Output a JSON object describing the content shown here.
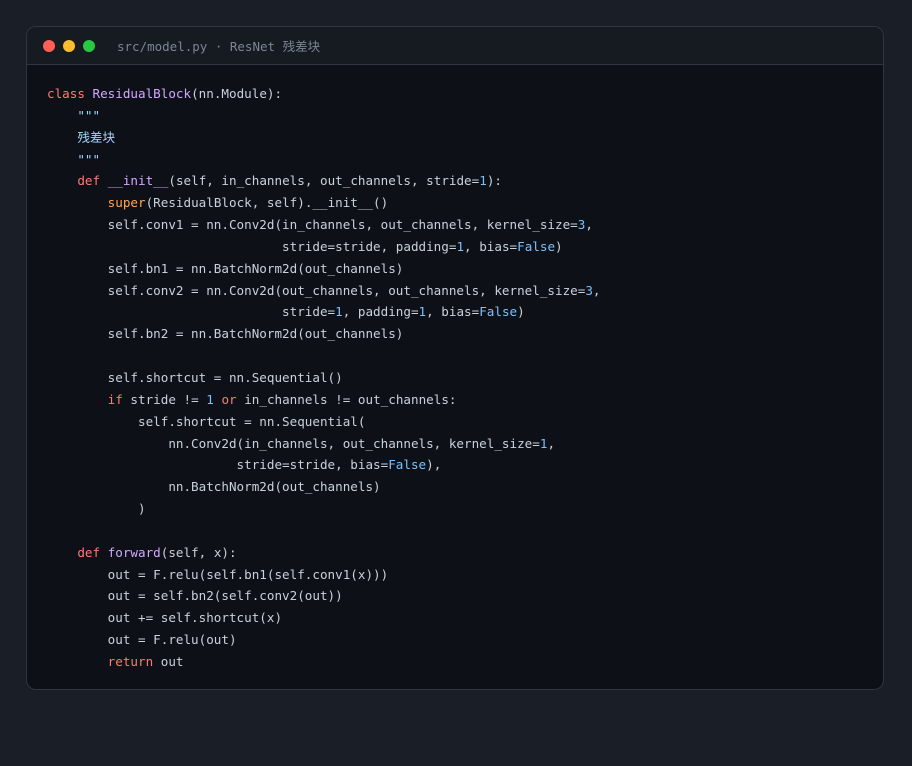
{
  "window": {
    "title": "src/model.py · ResNet 残差块"
  },
  "colors": {
    "background": "#1a1e26",
    "editor_bg": "#0d1117",
    "keyword": "#ff7b72",
    "function": "#d2a8ff",
    "builtin": "#ffa657",
    "number": "#79c0ff",
    "string": "#a5d6ff",
    "text": "#c9d1d9"
  },
  "code": {
    "language": "python",
    "lines": [
      [
        {
          "t": "class",
          "c": "kw"
        },
        {
          "t": " ",
          "c": "plain"
        },
        {
          "t": "ResidualBlock",
          "c": "fn"
        },
        {
          "t": "(nn.Module):",
          "c": "plain"
        }
      ],
      [
        {
          "t": "    \"\"\"",
          "c": "str"
        }
      ],
      [
        {
          "t": "    残差块",
          "c": "str"
        }
      ],
      [
        {
          "t": "    \"\"\"",
          "c": "str"
        }
      ],
      [
        {
          "t": "    ",
          "c": "plain"
        },
        {
          "t": "def",
          "c": "kw"
        },
        {
          "t": " ",
          "c": "plain"
        },
        {
          "t": "__init__",
          "c": "fn"
        },
        {
          "t": "(self, in_channels, out_channels, stride=",
          "c": "plain"
        },
        {
          "t": "1",
          "c": "num"
        },
        {
          "t": "):",
          "c": "plain"
        }
      ],
      [
        {
          "t": "        ",
          "c": "plain"
        },
        {
          "t": "super",
          "c": "bi"
        },
        {
          "t": "(ResidualBlock, self).__init__()",
          "c": "plain"
        }
      ],
      [
        {
          "t": "        self.conv1 = nn.Conv2d(in_channels, out_channels, kernel_size=",
          "c": "plain"
        },
        {
          "t": "3",
          "c": "num"
        },
        {
          "t": ",",
          "c": "plain"
        }
      ],
      [
        {
          "t": "                               stride=stride, padding=",
          "c": "plain"
        },
        {
          "t": "1",
          "c": "num"
        },
        {
          "t": ", bias=",
          "c": "plain"
        },
        {
          "t": "False",
          "c": "num"
        },
        {
          "t": ")",
          "c": "plain"
        }
      ],
      [
        {
          "t": "        self.bn1 = nn.BatchNorm2d(out_channels)",
          "c": "plain"
        }
      ],
      [
        {
          "t": "        self.conv2 = nn.Conv2d(out_channels, out_channels, kernel_size=",
          "c": "plain"
        },
        {
          "t": "3",
          "c": "num"
        },
        {
          "t": ",",
          "c": "plain"
        }
      ],
      [
        {
          "t": "                               stride=",
          "c": "plain"
        },
        {
          "t": "1",
          "c": "num"
        },
        {
          "t": ", padding=",
          "c": "plain"
        },
        {
          "t": "1",
          "c": "num"
        },
        {
          "t": ", bias=",
          "c": "plain"
        },
        {
          "t": "False",
          "c": "num"
        },
        {
          "t": ")",
          "c": "plain"
        }
      ],
      [
        {
          "t": "        self.bn2 = nn.BatchNorm2d(out_channels)",
          "c": "plain"
        }
      ],
      [],
      [
        {
          "t": "        self.shortcut = nn.Sequential()",
          "c": "plain"
        }
      ],
      [
        {
          "t": "        ",
          "c": "plain"
        },
        {
          "t": "if",
          "c": "kw"
        },
        {
          "t": " stride != ",
          "c": "plain"
        },
        {
          "t": "1",
          "c": "num"
        },
        {
          "t": " ",
          "c": "plain"
        },
        {
          "t": "or",
          "c": "kw"
        },
        {
          "t": " in_channels != out_channels:",
          "c": "plain"
        }
      ],
      [
        {
          "t": "            self.shortcut = nn.Sequential(",
          "c": "plain"
        }
      ],
      [
        {
          "t": "                nn.Conv2d(in_channels, out_channels, kernel_size=",
          "c": "plain"
        },
        {
          "t": "1",
          "c": "num"
        },
        {
          "t": ",",
          "c": "plain"
        }
      ],
      [
        {
          "t": "                         stride=stride, bias=",
          "c": "plain"
        },
        {
          "t": "False",
          "c": "num"
        },
        {
          "t": "),",
          "c": "plain"
        }
      ],
      [
        {
          "t": "                nn.BatchNorm2d(out_channels)",
          "c": "plain"
        }
      ],
      [
        {
          "t": "            )",
          "c": "plain"
        }
      ],
      [],
      [
        {
          "t": "    ",
          "c": "plain"
        },
        {
          "t": "def",
          "c": "kw"
        },
        {
          "t": " ",
          "c": "plain"
        },
        {
          "t": "forward",
          "c": "fn"
        },
        {
          "t": "(self, x):",
          "c": "plain"
        }
      ],
      [
        {
          "t": "        out = F.relu(self.bn1(self.conv1(x)))",
          "c": "plain"
        }
      ],
      [
        {
          "t": "        out = self.bn2(self.conv2(out))",
          "c": "plain"
        }
      ],
      [
        {
          "t": "        out += self.shortcut(x)",
          "c": "plain"
        }
      ],
      [
        {
          "t": "        out = F.relu(out)",
          "c": "plain"
        }
      ],
      [
        {
          "t": "        ",
          "c": "plain"
        },
        {
          "t": "return",
          "c": "kw"
        },
        {
          "t": " out",
          "c": "plain"
        }
      ]
    ]
  }
}
